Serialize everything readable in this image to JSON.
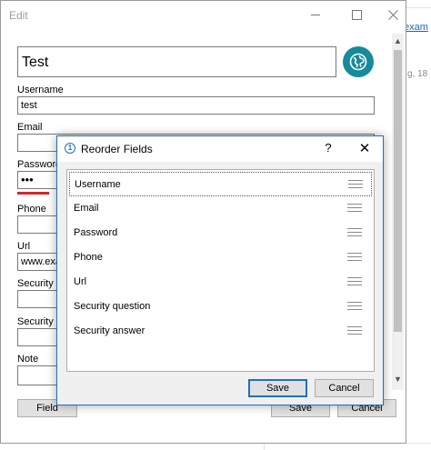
{
  "background": {
    "link_text": "exam",
    "muted_text": "g, 18"
  },
  "edit_window": {
    "title": "Edit",
    "name_value": "Test",
    "fields": [
      {
        "label": "Username",
        "value": "test"
      },
      {
        "label": "Email",
        "value": ""
      },
      {
        "label": "Password",
        "value": "•••"
      },
      {
        "label": "Phone",
        "value": ""
      },
      {
        "label": "Url",
        "value": "www.exa"
      },
      {
        "label": "Security q",
        "value": ""
      },
      {
        "label": "Security a",
        "value": ""
      },
      {
        "label": "Note",
        "value": ""
      }
    ],
    "field_button": "Field",
    "save_button": "Save",
    "cancel_button": "Cancel",
    "password_strength_color": "#d3262b",
    "globe_color": "#178a9b"
  },
  "reorder_dialog": {
    "title": "Reorder Fields",
    "help_label": "?",
    "close_label": "✕",
    "items": [
      "Username",
      "Email",
      "Password",
      "Phone",
      "Url",
      "Security question",
      "Security answer"
    ],
    "save_button": "Save",
    "cancel_button": "Cancel",
    "accent_color": "#1f6fc8"
  }
}
